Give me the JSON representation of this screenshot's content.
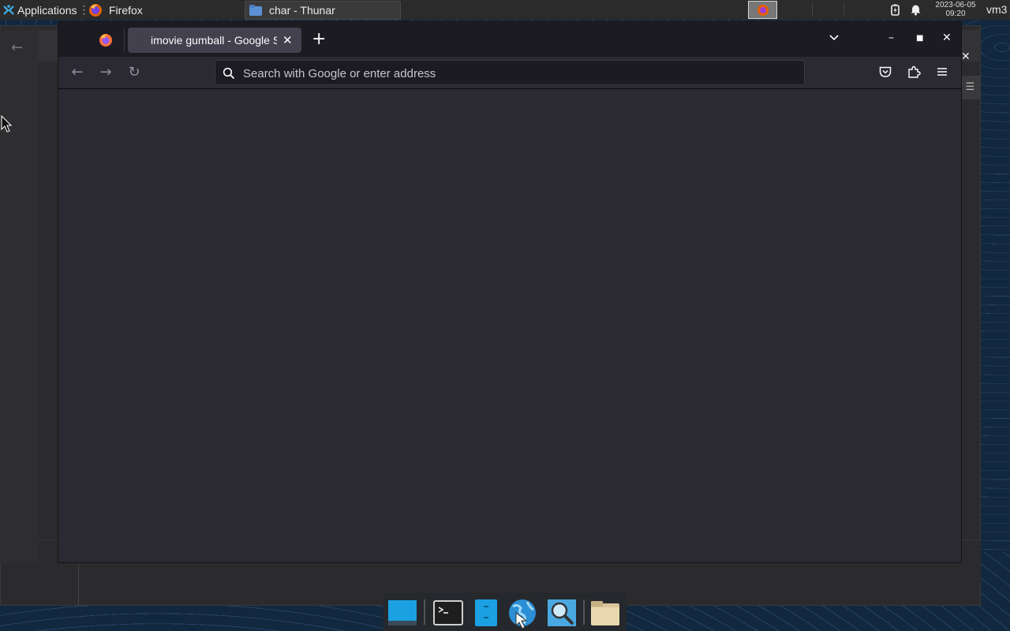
{
  "top_panel": {
    "apps_menu_label": "Applications",
    "apps_menu_sep": "⋮",
    "tasks": [
      {
        "label": "Firefox"
      },
      {
        "label": "char - Thunar"
      }
    ],
    "clock_date": "2023-06-05",
    "clock_time": "09:20",
    "user": "vm3"
  },
  "firefox": {
    "tab_title": "imovie gumball - Google Search",
    "new_tab_symbol": "+",
    "urlbar_placeholder": "Search with Google or enter address",
    "window_controls": {
      "minimize": "–",
      "maximize": "■",
      "close": "✕"
    },
    "nav": {
      "back": "←",
      "forward": "→",
      "reload": "↻"
    }
  },
  "thunar_background": {
    "back_symbol": "←",
    "close_symbol": "✕",
    "menu_symbol": "☰"
  },
  "dock": {
    "items": [
      "show-desktop-icon",
      "terminal-icon",
      "file-manager-icon",
      "web-browser-icon",
      "app-finder-icon",
      "folder-icon"
    ]
  },
  "colors": {
    "panel_bg": "#2b2b2b",
    "firefox_tabbar": "#1c1b22",
    "firefox_content": "#2b2a33",
    "desktop_bg": "#12283e"
  }
}
